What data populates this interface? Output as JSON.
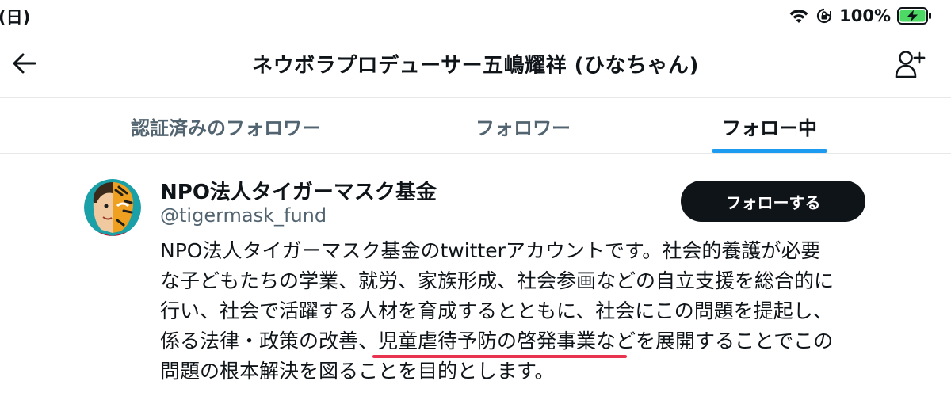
{
  "status_bar": {
    "time_fragment": "(日)",
    "battery_percent_label": "100%",
    "battery_level": 1.0,
    "icons": [
      "wifi-icon",
      "orientation-lock-icon",
      "battery-charging-icon"
    ]
  },
  "header": {
    "title": "ネウボラプロデューサー五嶋耀祥 (ひなちゃん)",
    "icons": [
      "arrow-left-icon",
      "add-user-icon"
    ]
  },
  "tabs": [
    {
      "label": "認証済みのフォロワー",
      "active": false
    },
    {
      "label": "フォロワー",
      "active": false
    },
    {
      "label": "フォロー中",
      "active": true
    }
  ],
  "user": {
    "name": "NPO法人タイガーマスク基金",
    "handle": "@tigermask_fund",
    "follow_label": "フォローする",
    "bio_lines": [
      "NPO法人タイガーマスク基金のtwitterアカウントです。社会的養護が必要",
      "な子どもたちの学業、就労、家族形成、社会参画などの自立支援を総合的に",
      "行い、社会で活躍する人材を育成するとともに、社会にこの問題を提起し、",
      "係る法律・政策の改善、児童虐待予防の啓発事業などを展開することでこの",
      "問題の根本解決を図ることを目的とします。"
    ],
    "highlighted_text": "児童虐待予防の啓発事業"
  },
  "colors": {
    "accent": "#1d9bf0",
    "text_primary": "#0f1419",
    "text_secondary": "#536471",
    "annotation_underline": "#e8344e",
    "battery_fill": "#4cd964"
  }
}
